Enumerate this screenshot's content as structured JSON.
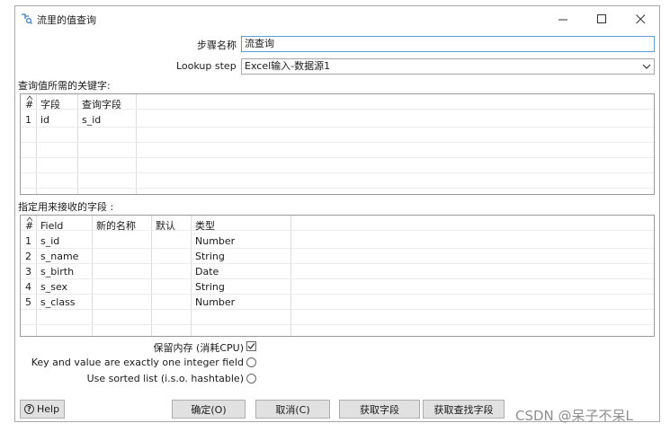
{
  "window": {
    "title": "流里的值查询",
    "minimize_glyph": "—",
    "maximize_glyph": "☐",
    "close_glyph": "✕"
  },
  "form": {
    "step_name_label": "步骤名称",
    "step_name_value": "流查询",
    "lookup_step_label": "Lookup step",
    "lookup_step_value": "Excel输入-数据源1"
  },
  "keys_section": {
    "label": "查询值所需的关键字:",
    "columns": [
      "#",
      "字段",
      "查询字段"
    ],
    "rows": [
      {
        "num": "1",
        "field": "id",
        "lookup_field": "s_id"
      }
    ]
  },
  "receive_section": {
    "label": "指定用来接收的字段 :",
    "columns": [
      "#",
      "Field",
      "新的名称",
      "默认",
      "类型"
    ],
    "rows": [
      {
        "num": "1",
        "field": "s_id",
        "new_name": "",
        "default": "",
        "type": "Number"
      },
      {
        "num": "2",
        "field": "s_name",
        "new_name": "",
        "default": "",
        "type": "String"
      },
      {
        "num": "3",
        "field": "s_birth",
        "new_name": "",
        "default": "",
        "type": "Date"
      },
      {
        "num": "4",
        "field": "s_sex",
        "new_name": "",
        "default": "",
        "type": "String"
      },
      {
        "num": "5",
        "field": "s_class",
        "new_name": "",
        "default": "",
        "type": "Number"
      }
    ]
  },
  "options": {
    "preserve_memory_label": "保留内存 (消耗CPU)",
    "preserve_memory_checked": true,
    "integer_key_label": "Key and value are exactly one integer field",
    "integer_key_selected": false,
    "sorted_list_label": "Use sorted list (i.s.o. hashtable)",
    "sorted_list_selected": false
  },
  "buttons": {
    "help": "Help",
    "ok": "确定(O)",
    "cancel": "取消(C)",
    "get_fields": "获取字段",
    "get_lookup_fields": "获取查找字段"
  },
  "watermark": "CSDN @呆子不呆L"
}
